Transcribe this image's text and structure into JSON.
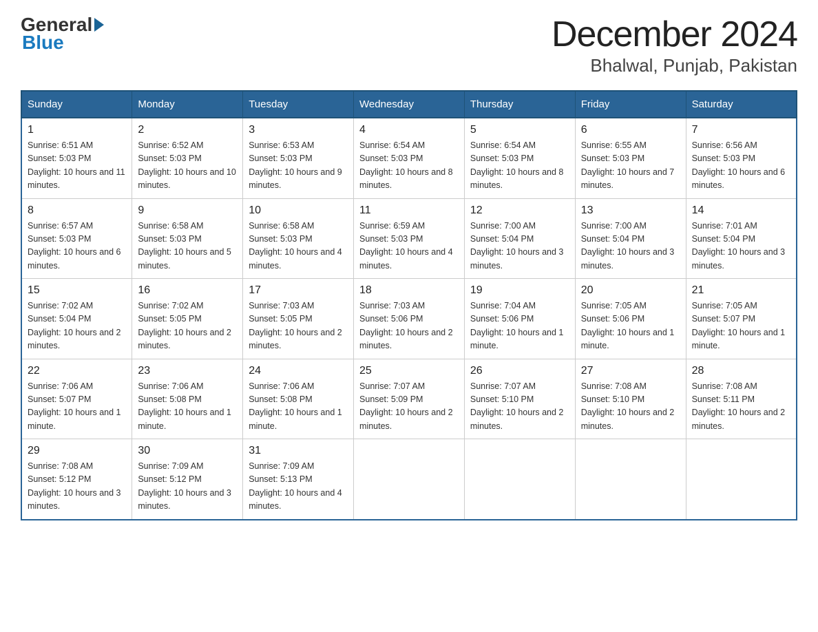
{
  "header": {
    "title": "December 2024",
    "subtitle": "Bhalwal, Punjab, Pakistan"
  },
  "days_of_week": [
    "Sunday",
    "Monday",
    "Tuesday",
    "Wednesday",
    "Thursday",
    "Friday",
    "Saturday"
  ],
  "weeks": [
    [
      {
        "day": "1",
        "sunrise": "6:51 AM",
        "sunset": "5:03 PM",
        "daylight": "10 hours and 11 minutes."
      },
      {
        "day": "2",
        "sunrise": "6:52 AM",
        "sunset": "5:03 PM",
        "daylight": "10 hours and 10 minutes."
      },
      {
        "day": "3",
        "sunrise": "6:53 AM",
        "sunset": "5:03 PM",
        "daylight": "10 hours and 9 minutes."
      },
      {
        "day": "4",
        "sunrise": "6:54 AM",
        "sunset": "5:03 PM",
        "daylight": "10 hours and 8 minutes."
      },
      {
        "day": "5",
        "sunrise": "6:54 AM",
        "sunset": "5:03 PM",
        "daylight": "10 hours and 8 minutes."
      },
      {
        "day": "6",
        "sunrise": "6:55 AM",
        "sunset": "5:03 PM",
        "daylight": "10 hours and 7 minutes."
      },
      {
        "day": "7",
        "sunrise": "6:56 AM",
        "sunset": "5:03 PM",
        "daylight": "10 hours and 6 minutes."
      }
    ],
    [
      {
        "day": "8",
        "sunrise": "6:57 AM",
        "sunset": "5:03 PM",
        "daylight": "10 hours and 6 minutes."
      },
      {
        "day": "9",
        "sunrise": "6:58 AM",
        "sunset": "5:03 PM",
        "daylight": "10 hours and 5 minutes."
      },
      {
        "day": "10",
        "sunrise": "6:58 AM",
        "sunset": "5:03 PM",
        "daylight": "10 hours and 4 minutes."
      },
      {
        "day": "11",
        "sunrise": "6:59 AM",
        "sunset": "5:03 PM",
        "daylight": "10 hours and 4 minutes."
      },
      {
        "day": "12",
        "sunrise": "7:00 AM",
        "sunset": "5:04 PM",
        "daylight": "10 hours and 3 minutes."
      },
      {
        "day": "13",
        "sunrise": "7:00 AM",
        "sunset": "5:04 PM",
        "daylight": "10 hours and 3 minutes."
      },
      {
        "day": "14",
        "sunrise": "7:01 AM",
        "sunset": "5:04 PM",
        "daylight": "10 hours and 3 minutes."
      }
    ],
    [
      {
        "day": "15",
        "sunrise": "7:02 AM",
        "sunset": "5:04 PM",
        "daylight": "10 hours and 2 minutes."
      },
      {
        "day": "16",
        "sunrise": "7:02 AM",
        "sunset": "5:05 PM",
        "daylight": "10 hours and 2 minutes."
      },
      {
        "day": "17",
        "sunrise": "7:03 AM",
        "sunset": "5:05 PM",
        "daylight": "10 hours and 2 minutes."
      },
      {
        "day": "18",
        "sunrise": "7:03 AM",
        "sunset": "5:06 PM",
        "daylight": "10 hours and 2 minutes."
      },
      {
        "day": "19",
        "sunrise": "7:04 AM",
        "sunset": "5:06 PM",
        "daylight": "10 hours and 1 minute."
      },
      {
        "day": "20",
        "sunrise": "7:05 AM",
        "sunset": "5:06 PM",
        "daylight": "10 hours and 1 minute."
      },
      {
        "day": "21",
        "sunrise": "7:05 AM",
        "sunset": "5:07 PM",
        "daylight": "10 hours and 1 minute."
      }
    ],
    [
      {
        "day": "22",
        "sunrise": "7:06 AM",
        "sunset": "5:07 PM",
        "daylight": "10 hours and 1 minute."
      },
      {
        "day": "23",
        "sunrise": "7:06 AM",
        "sunset": "5:08 PM",
        "daylight": "10 hours and 1 minute."
      },
      {
        "day": "24",
        "sunrise": "7:06 AM",
        "sunset": "5:08 PM",
        "daylight": "10 hours and 1 minute."
      },
      {
        "day": "25",
        "sunrise": "7:07 AM",
        "sunset": "5:09 PM",
        "daylight": "10 hours and 2 minutes."
      },
      {
        "day": "26",
        "sunrise": "7:07 AM",
        "sunset": "5:10 PM",
        "daylight": "10 hours and 2 minutes."
      },
      {
        "day": "27",
        "sunrise": "7:08 AM",
        "sunset": "5:10 PM",
        "daylight": "10 hours and 2 minutes."
      },
      {
        "day": "28",
        "sunrise": "7:08 AM",
        "sunset": "5:11 PM",
        "daylight": "10 hours and 2 minutes."
      }
    ],
    [
      {
        "day": "29",
        "sunrise": "7:08 AM",
        "sunset": "5:12 PM",
        "daylight": "10 hours and 3 minutes."
      },
      {
        "day": "30",
        "sunrise": "7:09 AM",
        "sunset": "5:12 PM",
        "daylight": "10 hours and 3 minutes."
      },
      {
        "day": "31",
        "sunrise": "7:09 AM",
        "sunset": "5:13 PM",
        "daylight": "10 hours and 4 minutes."
      },
      null,
      null,
      null,
      null
    ]
  ]
}
